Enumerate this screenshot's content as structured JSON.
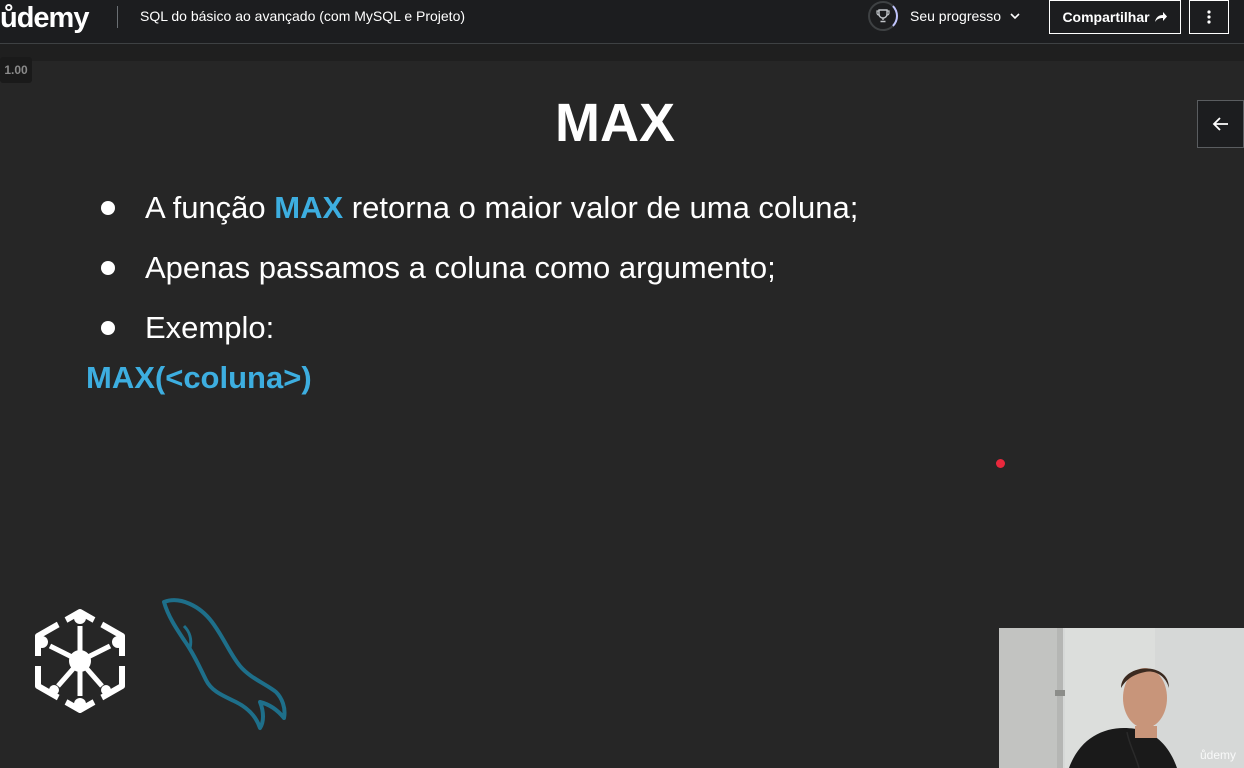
{
  "header": {
    "logo_text": "ůdemy",
    "course_title": "SQL do básico ao avançado (com MySQL e Projeto)",
    "progress_label": "Seu progresso",
    "share_label": "Compartilhar"
  },
  "player": {
    "speed": "1.00"
  },
  "slide": {
    "title": "MAX",
    "bullets": [
      {
        "before": "A função ",
        "highlight": "MAX",
        "after": " retorna o maior valor de uma coluna;"
      },
      {
        "text": "Apenas passamos a coluna como argumento;"
      },
      {
        "text": "Exemplo:"
      }
    ],
    "syntax": "MAX(<coluna>)"
  },
  "webcam": {
    "watermark": "ůdemy"
  },
  "colors": {
    "brand_accent": "#a435f0",
    "slide_highlight": "#3daee0",
    "pointer": "#e8283c",
    "background": "#1c1d1f"
  },
  "icons": {
    "progress": "trophy-icon",
    "progress_dropdown": "chevron-down-icon",
    "share": "share-arrow-icon",
    "more": "kebab-menu-icon",
    "side_panel": "arrow-left-icon"
  }
}
